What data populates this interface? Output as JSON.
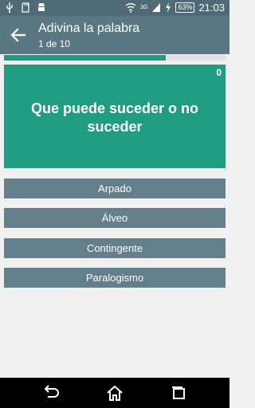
{
  "status_bar": {
    "time": "21:03",
    "battery": "63%",
    "network": "3G",
    "icons": [
      "usb-icon",
      "sd-card-icon",
      "android-icon",
      "wifi-icon",
      "signal-icon",
      "charging-icon",
      "battery-icon"
    ]
  },
  "app_bar": {
    "title": "Adivina la palabra",
    "subtitle": "1 de 10",
    "back_icon": "arrow-left-icon"
  },
  "progress": {
    "fraction": 0.73,
    "color": "#1f9c82"
  },
  "question": {
    "text": "Que puede suceder o no suceder",
    "score": "0",
    "color": "#1f9c82"
  },
  "options": [
    {
      "label": "Arpado"
    },
    {
      "label": "Álveo"
    },
    {
      "label": "Contingente"
    },
    {
      "label": "Paralogismo"
    }
  ],
  "nav_bar": {
    "icons": [
      "back-icon",
      "home-icon",
      "recents-icon"
    ]
  },
  "colors": {
    "status_bar": "#4e6a77",
    "app_bar": "#5a7884",
    "option": "#637f8b",
    "background": "#f0f0f0"
  }
}
